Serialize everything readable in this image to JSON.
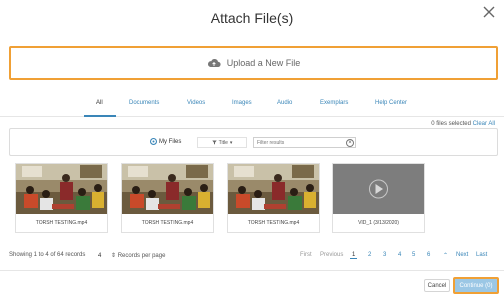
{
  "dialog": {
    "title": "Attach File(s)"
  },
  "upload": {
    "label": "Upload a New File",
    "icon": "cloud-upload-icon",
    "highlight_color": "#f0a035"
  },
  "tabs": [
    {
      "label": "All",
      "active": true
    },
    {
      "label": "Documents"
    },
    {
      "label": "Videos"
    },
    {
      "label": "Images"
    },
    {
      "label": "Audio"
    },
    {
      "label": "Exemplars"
    },
    {
      "label": "Help Center"
    }
  ],
  "selection": {
    "text": "0 files selected",
    "clear_label": "Clear All"
  },
  "filters": {
    "scope_label": "My Files",
    "filter_button": "Title",
    "search_placeholder": "Filter results",
    "clear_icon": "x-circle-icon"
  },
  "files": [
    {
      "name": "TORSH TESTING.mp4",
      "kind": "classroom"
    },
    {
      "name": "TORSH TESTING.mp4",
      "kind": "classroom"
    },
    {
      "name": "TORSH TESTING.mp4",
      "kind": "classroom"
    },
    {
      "name": "VID_1 (3/13/2020)",
      "kind": "placeholder"
    }
  ],
  "footer": {
    "showing": "Showing 1 to 4 of 64 records",
    "per_page_value": "4",
    "per_page_label": "Records per page",
    "pager": {
      "first": "First",
      "previous": "Previous",
      "pages": [
        "1",
        "2",
        "3",
        "4",
        "5",
        "6"
      ],
      "current": "1",
      "next": "Next",
      "last": "Last"
    }
  },
  "actions": {
    "cancel": "Cancel",
    "continue": "Continue (0)"
  },
  "colors": {
    "accent": "#3a86b8",
    "highlight": "#f0a035",
    "continue_bg": "#9bc7e5"
  }
}
